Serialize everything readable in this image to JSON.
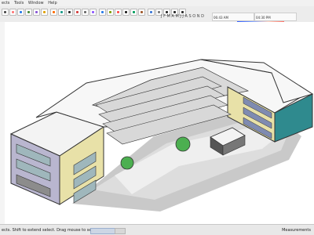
{
  "menubar": {
    "items": [
      "ects",
      "Tools",
      "Window",
      "Help"
    ]
  },
  "toolbar": {
    "icons": [
      {
        "name": "select-icon",
        "color": "#4b4b4b"
      },
      {
        "name": "eraser-icon",
        "color": "#ff7a7a"
      },
      {
        "name": "line-icon",
        "color": "#2b7de9"
      },
      {
        "name": "arc-icon",
        "color": "#4b8c3c"
      },
      {
        "name": "rectangle-icon",
        "color": "#8a59d6"
      },
      {
        "name": "circle-icon",
        "color": "#e0a100"
      },
      {
        "name": "polygon-icon",
        "color": "#ff6d00"
      },
      {
        "name": "push-pull-icon",
        "color": "#1c9c8a"
      },
      {
        "name": "move-icon",
        "color": "#2a2a2a"
      },
      {
        "name": "rotate-icon",
        "color": "#d43f3f"
      },
      {
        "name": "scale-icon",
        "color": "#6a6a6a"
      },
      {
        "name": "offset-icon",
        "color": "#8f5bff"
      },
      {
        "name": "tape-icon",
        "color": "#2b7de9"
      },
      {
        "name": "dimension-icon",
        "color": "#7fa000"
      },
      {
        "name": "protractor-icon",
        "color": "#ff4d4d"
      },
      {
        "name": "text-icon",
        "color": "#222222"
      },
      {
        "name": "axes-icon",
        "color": "#009f5f"
      },
      {
        "name": "3d-text-icon",
        "color": "#a05a2c"
      },
      {
        "name": "orbit-icon",
        "color": "#3f7ad6"
      },
      {
        "name": "pan-icon",
        "color": "#7a7a7a"
      },
      {
        "name": "zoom-icon",
        "color": "#2b2b2b"
      },
      {
        "name": "zoom-window-icon",
        "color": "#2b2b2b"
      },
      {
        "name": "zoom-extents-icon",
        "color": "#2b2b2b"
      }
    ],
    "months": "J F M A M J J A S O N D",
    "time1": "06:43 AM",
    "time2": "04:30 PM"
  },
  "status": {
    "message": "ects. Shift to extend select. Drag mouse to select multiple.",
    "measurements": "Measurements"
  },
  "canvas": {
    "label": "",
    "model_colors": {
      "roof": "#f5f5f5",
      "wall_yellow": "#e8e1a8",
      "wall_lavender": "#b9b6cf",
      "window_blue": "#9fb7bc",
      "teal": "#2f8a8e"
    }
  }
}
